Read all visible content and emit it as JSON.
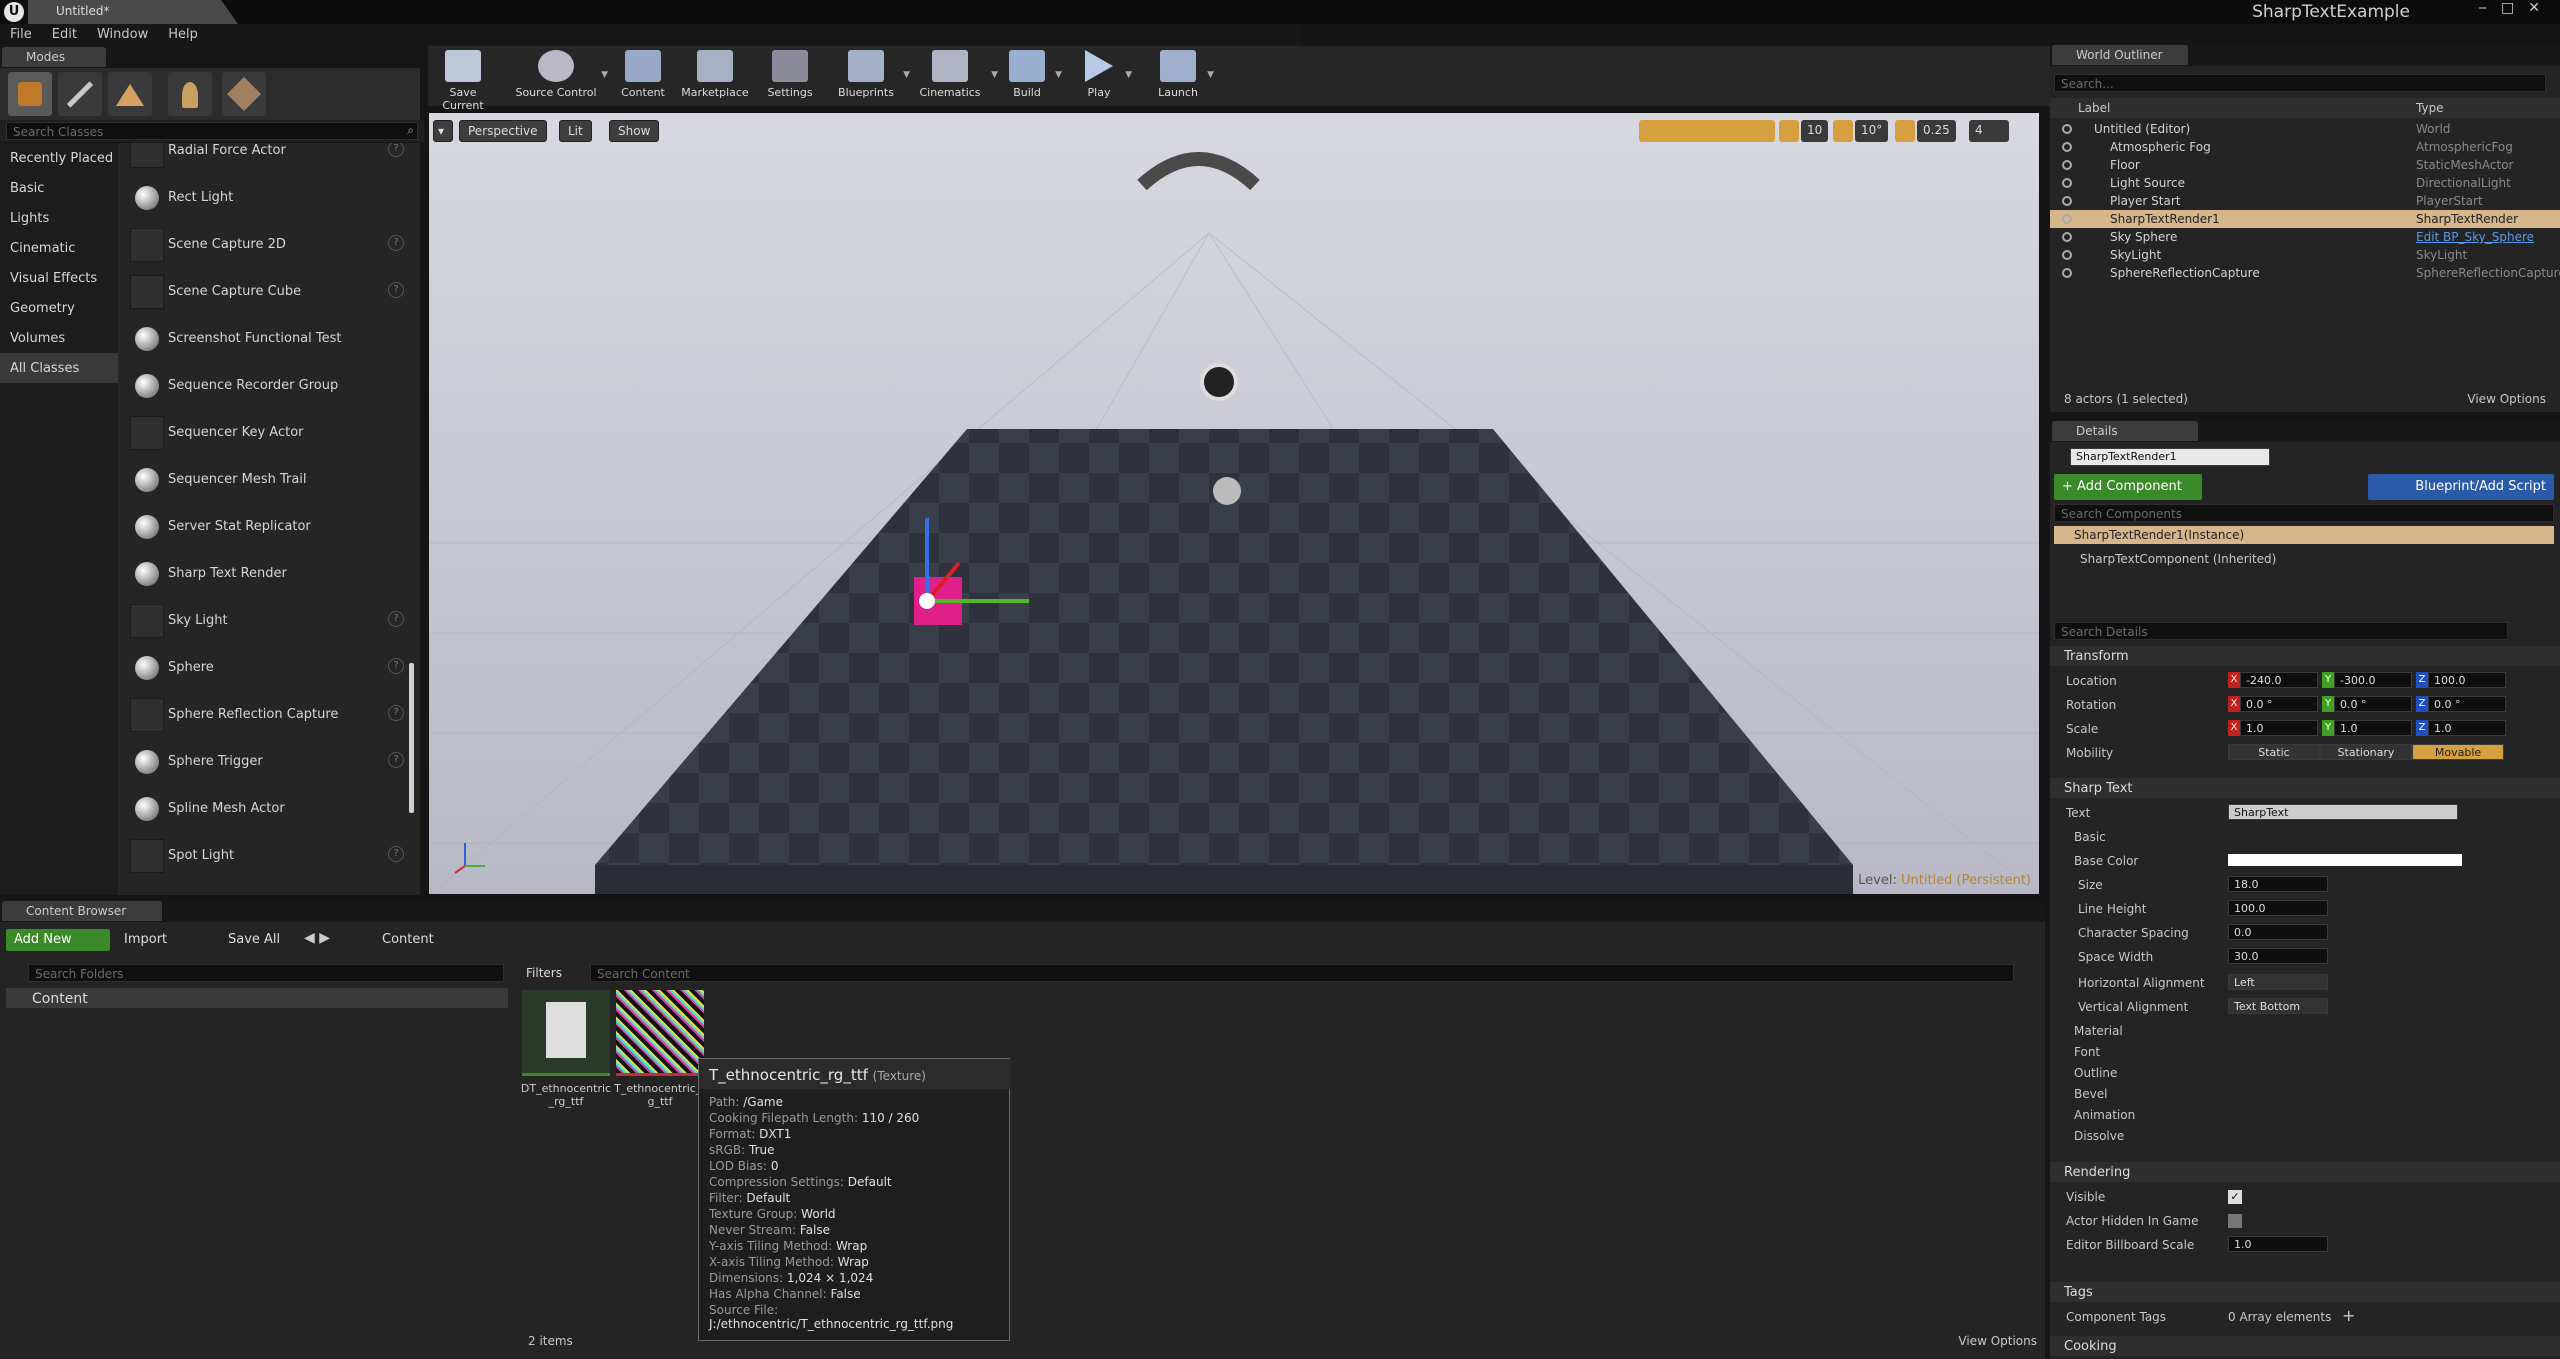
{
  "window": {
    "doc_tab": "Untitled*",
    "project_name": "SharpTextExample"
  },
  "menu": [
    "File",
    "Edit",
    "Window",
    "Help"
  ],
  "modes": {
    "tab": "Modes",
    "search_placeholder": "Search Classes",
    "categories": [
      "Recently Placed",
      "Basic",
      "Lights",
      "Cinematic",
      "Visual Effects",
      "Geometry",
      "Volumes",
      "All Classes"
    ],
    "items": [
      "Radial Force Actor",
      "Rect Light",
      "Scene Capture 2D",
      "Scene Capture Cube",
      "Screenshot Functional Test",
      "Sequence Recorder Group",
      "Sequencer Key Actor",
      "Sequencer Mesh Trail",
      "Server Stat Replicator",
      "Sharp Text Render",
      "Sky Light",
      "Sphere",
      "Sphere Reflection Capture",
      "Sphere Trigger",
      "Spline Mesh Actor",
      "Spot Light"
    ]
  },
  "toolbar": {
    "buttons": [
      "Save Current",
      "Source Control",
      "Content",
      "Marketplace",
      "Settings",
      "Blueprints",
      "Cinematics",
      "Build",
      "Play",
      "Launch"
    ]
  },
  "viewport": {
    "perspective": "Perspective",
    "lit": "Lit",
    "show": "Show",
    "grid_snap": "10",
    "rot_snap": "10°",
    "scale_snap": "0.25",
    "cam_speed": "4",
    "level_label": "Level:",
    "level_name": "Untitled (Persistent)"
  },
  "outliner": {
    "tab": "World Outliner",
    "search_placeholder": "Search...",
    "col_label": "Label",
    "col_type": "Type",
    "rows": [
      {
        "name": "Untitled (Editor)",
        "type": "World"
      },
      {
        "name": "Atmospheric Fog",
        "type": "AtmosphericFog"
      },
      {
        "name": "Floor",
        "type": "StaticMeshActor"
      },
      {
        "name": "Light Source",
        "type": "DirectionalLight"
      },
      {
        "name": "Player Start",
        "type": "PlayerStart"
      },
      {
        "name": "SharpTextRender1",
        "type": "SharpTextRender"
      },
      {
        "name": "Sky Sphere",
        "type": "Edit BP_Sky_Sphere"
      },
      {
        "name": "SkyLight",
        "type": "SkyLight"
      },
      {
        "name": "SphereReflectionCapture",
        "type": "SphereReflectionCapture"
      }
    ],
    "status": "8 actors (1 selected)",
    "view_options": "View Options"
  },
  "details": {
    "tab": "Details",
    "actor_name": "SharpTextRender1",
    "add_component": "+ Add Component",
    "blueprint_script": "Blueprint/Add Script",
    "search_components": "Search Components",
    "instance": "SharpTextRender1(Instance)",
    "component": "SharpTextComponent (Inherited)",
    "search_details": "Search Details",
    "transform": "Transform",
    "location_label": "Location",
    "rotation_label": "Rotation",
    "scale_label": "Scale",
    "mobility_label": "Mobility",
    "loc": [
      "-240.0",
      "-300.0",
      "100.0"
    ],
    "rot": [
      "0.0 °",
      "0.0 °",
      "0.0 °"
    ],
    "scale": [
      "1.0",
      "1.0",
      "1.0"
    ],
    "mobility": [
      "Static",
      "Stationary",
      "Movable"
    ],
    "sharp_text": "Sharp Text",
    "text_label": "Text",
    "text_value": "SharpText",
    "basic": "Basic",
    "base_color": "Base Color",
    "size_label": "Size",
    "size": "18.0",
    "line_height_label": "Line Height",
    "line_height": "100.0",
    "char_spacing_label": "Character Spacing",
    "char_spacing": "0.0",
    "space_width_label": "Space Width",
    "space_width": "30.0",
    "halign_label": "Horizontal Alignment",
    "halign": "Left",
    "valign_label": "Vertical Alignment",
    "valign": "Text Bottom",
    "subsections": [
      "Material",
      "Font",
      "Outline",
      "Bevel",
      "Animation",
      "Dissolve"
    ],
    "rendering": "Rendering",
    "visible_label": "Visible",
    "actor_hidden_label": "Actor Hidden In Game",
    "billboard_label": "Editor Billboard Scale",
    "billboard": "1.0",
    "tags": "Tags",
    "component_tags_label": "Component Tags",
    "component_tags": "0 Array elements",
    "cooking": "Cooking"
  },
  "content_browser": {
    "tab": "Content Browser",
    "add_new": "Add New",
    "import": "Import",
    "save_all": "Save All",
    "path": "Content",
    "search_folders": "Search Folders",
    "folder": "Content",
    "filters": "Filters",
    "search_content": "Search Content",
    "assets": [
      "DT_ethnocentric_rg_ttf",
      "T_ethnocentric_rg_ttf"
    ],
    "count": "2 items",
    "view_options": "View Options"
  },
  "tooltip": {
    "title": "T_ethnocentric_rg_ttf",
    "title_type": "(Texture)",
    "lines": [
      {
        "k": "Path:",
        "v": "/Game"
      },
      {
        "k": "Cooking Filepath Length:",
        "v": "110 / 260"
      },
      {
        "k": "Format:",
        "v": "DXT1"
      },
      {
        "k": "sRGB:",
        "v": "True"
      },
      {
        "k": "LOD Bias:",
        "v": "0"
      },
      {
        "k": "Compression Settings:",
        "v": "Default"
      },
      {
        "k": "Filter:",
        "v": "Default"
      },
      {
        "k": "Texture Group:",
        "v": "World"
      },
      {
        "k": "Never Stream:",
        "v": "False"
      },
      {
        "k": "Y-axis Tiling Method:",
        "v": "Wrap"
      },
      {
        "k": "X-axis Tiling Method:",
        "v": "Wrap"
      },
      {
        "k": "Dimensions:",
        "v": "1,024 × 1,024"
      },
      {
        "k": "Has Alpha Channel:",
        "v": "False"
      },
      {
        "k": "Source File:",
        "v": "J:/ethnocentric/T_ethnocentric_rg_ttf.png"
      }
    ]
  },
  "colors": {
    "accent_orange": "#d6a040",
    "green_button": "#3a8a2a",
    "blue_button": "#2a5aa8",
    "selection": "#d6b68a"
  }
}
